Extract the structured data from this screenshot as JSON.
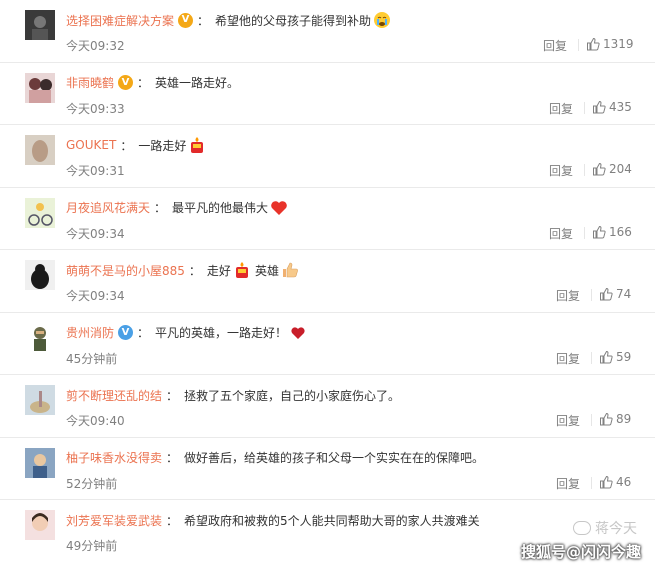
{
  "comments": [
    {
      "user": "选择困难症解决方案",
      "badge": "gold",
      "text": "希望他的父母孩子能得到补助",
      "emoji": "crying",
      "time": "今天09:32",
      "reply": "回复",
      "likes": "1319"
    },
    {
      "user": "非雨曉鹤",
      "badge": "gold",
      "text": "英雄一路走好。",
      "emoji": "",
      "time": "今天09:33",
      "reply": "回复",
      "likes": "435"
    },
    {
      "user": "GOUKET",
      "badge": "",
      "text": "一路走好",
      "emoji": "candle",
      "time": "今天09:31",
      "reply": "回复",
      "likes": "204"
    },
    {
      "user": "月夜追风花满天",
      "badge": "",
      "text": "最平凡的他最伟大",
      "emoji": "heart",
      "time": "今天09:34",
      "reply": "回复",
      "likes": "166"
    },
    {
      "user": "萌萌不是马的小屋885",
      "badge": "",
      "text": "走好",
      "emoji": "candle",
      "text2": "英雄",
      "emoji2": "thumb",
      "time": "今天09:34",
      "reply": "回复",
      "likes": "74"
    },
    {
      "user": "贵州消防",
      "badge": "blue",
      "text": "平凡的英雄，一路走好！",
      "emoji": "heart-small",
      "time": "45分钟前",
      "reply": "回复",
      "likes": "59"
    },
    {
      "user": "剪不断理还乱的结",
      "badge": "",
      "text": "拯救了五个家庭，自己的小家庭伤心了。",
      "emoji": "",
      "time": "今天09:40",
      "reply": "回复",
      "likes": "89"
    },
    {
      "user": "柚子味香水没得卖",
      "badge": "",
      "text": "做好善后，给英雄的孩子和父母一个实实在在的保障吧。",
      "emoji": "",
      "time": "52分钟前",
      "reply": "回复",
      "likes": "46"
    },
    {
      "user": "刘芳爱军装爱武装",
      "badge": "",
      "text": "希望政府和被救的5个人能共同帮助大哥的家人共渡难关",
      "emoji": "",
      "time": "49分钟前",
      "reply": "",
      "likes": ""
    }
  ],
  "watermark": {
    "main": "搜狐号@闪闪今趣",
    "sub": "蒋今天"
  },
  "colors": {
    "username": "#eb7350",
    "meta": "#808080",
    "gold_badge": "#f4a817",
    "blue_badge": "#4aa0e6"
  }
}
